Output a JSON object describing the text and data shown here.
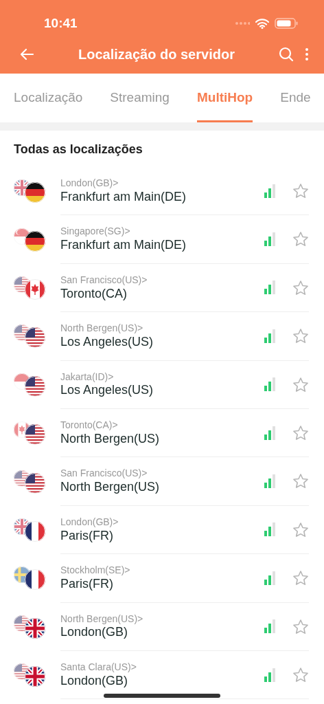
{
  "status_bar": {
    "time": "10:41"
  },
  "header": {
    "title": "Localização do servidor"
  },
  "tabs": [
    {
      "label": "Localização",
      "selected": false
    },
    {
      "label": "Streaming",
      "selected": false
    },
    {
      "label": "MultiHop",
      "selected": true
    },
    {
      "label": "Ende",
      "selected": false
    }
  ],
  "section_title": "Todas as localizações",
  "servers": [
    {
      "entry": "London(GB)>",
      "exit": "Frankfurt am Main(DE)",
      "entry_flag": {
        "kind": "gb"
      },
      "exit_flag": {
        "kind": "de"
      },
      "favorite": false
    },
    {
      "entry": "Singapore(SG)>",
      "exit": "Frankfurt am Main(DE)",
      "entry_flag": {
        "kind": "sg"
      },
      "exit_flag": {
        "kind": "de"
      },
      "favorite": false
    },
    {
      "entry": "San Francisco(US)>",
      "exit": "Toronto(CA)",
      "entry_flag": {
        "kind": "us"
      },
      "exit_flag": {
        "kind": "ca"
      },
      "favorite": false
    },
    {
      "entry": "North Bergen(US)>",
      "exit": "Los Angeles(US)",
      "entry_flag": {
        "kind": "us"
      },
      "exit_flag": {
        "kind": "us"
      },
      "favorite": false
    },
    {
      "entry": "Jakarta(ID)>",
      "exit": "Los Angeles(US)",
      "entry_flag": {
        "kind": "id"
      },
      "exit_flag": {
        "kind": "us"
      },
      "favorite": false
    },
    {
      "entry": "Toronto(CA)>",
      "exit": "North Bergen(US)",
      "entry_flag": {
        "kind": "ca"
      },
      "exit_flag": {
        "kind": "us"
      },
      "favorite": false
    },
    {
      "entry": "San Francisco(US)>",
      "exit": "North Bergen(US)",
      "entry_flag": {
        "kind": "us"
      },
      "exit_flag": {
        "kind": "us"
      },
      "favorite": false
    },
    {
      "entry": "London(GB)>",
      "exit": "Paris(FR)",
      "entry_flag": {
        "kind": "gb"
      },
      "exit_flag": {
        "kind": "fr"
      },
      "favorite": false
    },
    {
      "entry": "Stockholm(SE)>",
      "exit": "Paris(FR)",
      "entry_flag": {
        "kind": "se"
      },
      "exit_flag": {
        "kind": "fr"
      },
      "favorite": false
    },
    {
      "entry": "North Bergen(US)>",
      "exit": "London(GB)",
      "entry_flag": {
        "kind": "us"
      },
      "exit_flag": {
        "kind": "gb"
      },
      "favorite": false
    },
    {
      "entry": "Santa Clara(US)>",
      "exit": "London(GB)",
      "entry_flag": {
        "kind": "us"
      },
      "exit_flag": {
        "kind": "gb"
      },
      "favorite": false
    }
  ]
}
